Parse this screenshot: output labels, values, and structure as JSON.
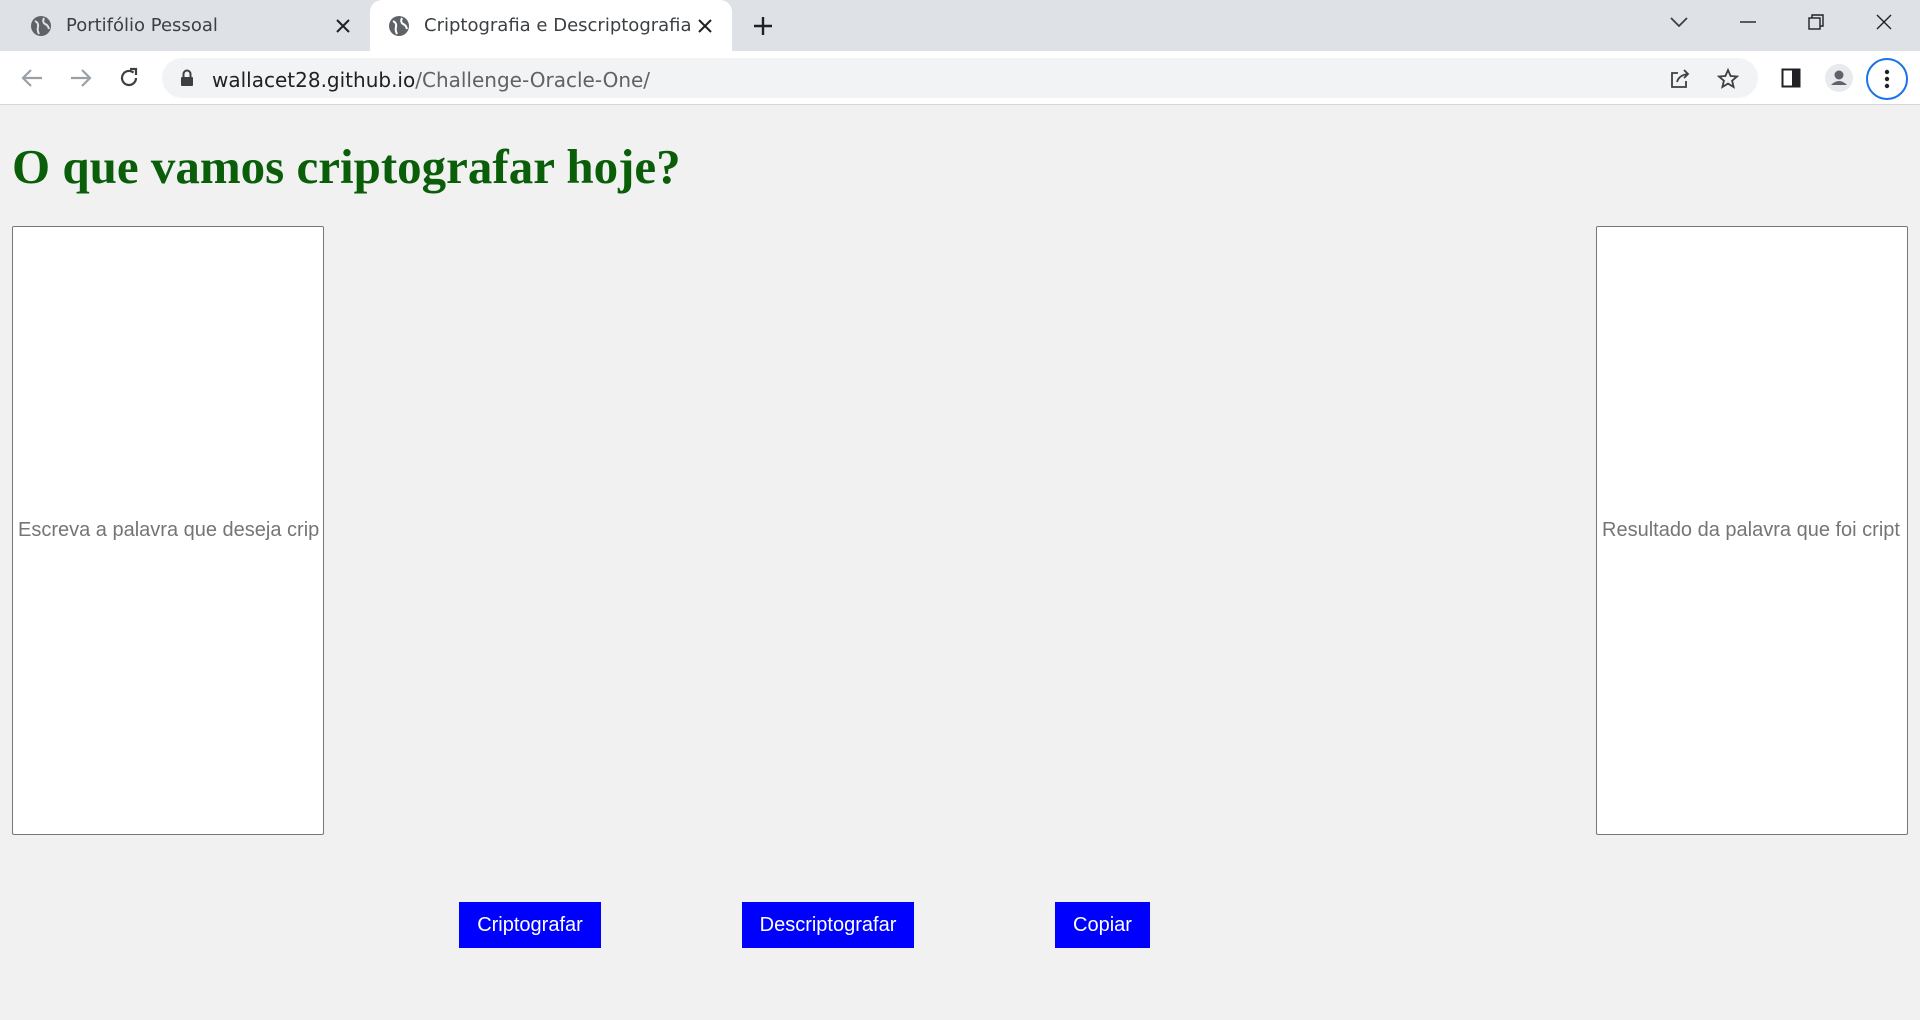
{
  "browser": {
    "tabs": [
      {
        "title": "Portifólio Pessoal",
        "active": false
      },
      {
        "title": "Criptografia e Descriptografia",
        "active": true
      }
    ],
    "url": {
      "host": "wallacet28.github.io",
      "path": "/Challenge-Oracle-One/"
    }
  },
  "page": {
    "heading": "O que vamos criptografar hoje?",
    "input": {
      "placeholder": "Escreva a palavra que deseja crip"
    },
    "output": {
      "placeholder": "Resultado da palavra que foi cript"
    },
    "buttons": {
      "encrypt": "Criptografar",
      "decrypt": "Descriptografar",
      "copy": "Copiar"
    }
  },
  "colors": {
    "heading": "#0a5e0a",
    "button_bg": "#0000ff",
    "button_text": "#ffffff",
    "page_bg": "#f1f1f1"
  }
}
